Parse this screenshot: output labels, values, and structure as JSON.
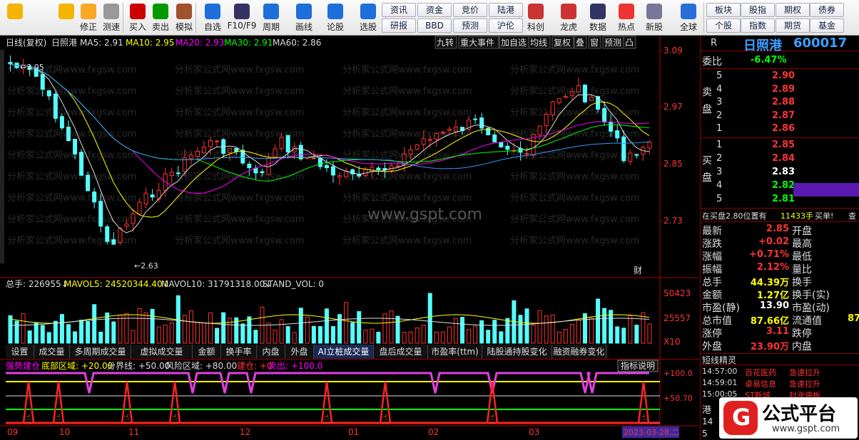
{
  "toolbar": {
    "items": [
      {
        "name": "back-button",
        "label": "",
        "icon": "arrow-left-icon"
      },
      {
        "name": "up-button",
        "label": "",
        "icon": "arrow-up-icon"
      },
      {
        "name": "fix-button",
        "label": "修正",
        "icon": "fix-icon"
      },
      {
        "name": "test-button",
        "label": "测速",
        "icon": "clock-icon"
      },
      {
        "name": "buy-button",
        "label": "买入",
        "icon": "buy-icon"
      },
      {
        "name": "sell-button",
        "label": "卖出",
        "icon": "sell-icon"
      },
      {
        "name": "simulate-button",
        "label": "模拟",
        "icon": "hammer-icon"
      },
      {
        "name": "favorite-button",
        "label": "自选",
        "icon": "star-icon"
      },
      {
        "name": "f10-button",
        "label": "F10/F9",
        "icon": "f10-icon"
      },
      {
        "name": "period-button",
        "label": "周期",
        "icon": "period-icon"
      },
      {
        "name": "draw-button",
        "label": "画线",
        "icon": "pencil-icon"
      },
      {
        "name": "discuss-button",
        "label": "论股",
        "icon": "discuss-icon"
      },
      {
        "name": "select-button",
        "label": "选股",
        "icon": "gauge-icon"
      },
      {
        "name": "fortune-button",
        "label": "科创",
        "icon": "chart-icon"
      },
      {
        "name": "dragon-button",
        "label": "龙虎",
        "icon": "dragon-icon"
      },
      {
        "name": "data-button",
        "label": "数据",
        "icon": "pe-icon"
      },
      {
        "name": "hot-button",
        "label": "热点",
        "icon": "fire-icon"
      },
      {
        "name": "ipo-button",
        "label": "新股",
        "icon": "ipo-icon"
      },
      {
        "name": "global-button",
        "label": "全球",
        "icon": "globe-icon"
      }
    ],
    "small": [
      "资讯",
      "资金",
      "竞价",
      "陆港",
      "研报",
      "BBD",
      "预测",
      "沪伦"
    ],
    "right": [
      "板块",
      "股指",
      "期权",
      "债券",
      "个股",
      "指数",
      "期货",
      "基金"
    ]
  },
  "header": {
    "period": "日线(复权)",
    "stock": "日照港",
    "ma5": "MA5: 2.91",
    "ma10": "MA10: 2.95",
    "ma20": "MA20: 2.93",
    "ma30": "MA30: 2.91",
    "ma60": "MA60: 2.86",
    "tools": [
      "九转",
      "重大事件",
      "加自选",
      "均线",
      "复权",
      "叠",
      "窗",
      "预测",
      "凸"
    ]
  },
  "price_axis": [
    "3.09",
    "2.97",
    "2.85",
    "2.73"
  ],
  "hi_label": "3.05",
  "lo_label": "2.63",
  "fin_mark": "财",
  "watermark": "www.gspt.com",
  "watermark_small": "分析家公式网www.fxgsw.com",
  "volume": {
    "label": "总手: 226955↓",
    "mavol5": "MAVOL5: 24520344.40↓",
    "mavol10": "MAVOL10: 31791318.00↓",
    "stand": "STAND_VOL: 0",
    "axis": [
      "50423",
      "25557",
      "X10"
    ]
  },
  "tabs": [
    "设置",
    "成交量",
    "多周期成交量",
    "虚拟成交量",
    "金额",
    "换手率",
    "内盘",
    "外盘",
    "AI立桩成交量",
    "盘后成交量",
    "市盈率(ttm)",
    "陆股通持股变化",
    "融资融券变化"
  ],
  "active_tab": "AI立桩成交量",
  "indicator": {
    "l1": "强势建仓",
    "l2": "底部区域: +20.00",
    "l3": "分界线: +50.00",
    "l4": "风险区域: +80.00",
    "l5": "建仓: +0",
    "l6": "卖出: +100.0",
    "btn": "指标说明",
    "axis": [
      "+100.0",
      "+50.70"
    ]
  },
  "dates": [
    "09",
    "10",
    "11",
    "12",
    "01",
    "02",
    "03",
    "2023-03-28,二"
  ],
  "right_panel": {
    "r": "R",
    "name": "日照港",
    "code": "600017",
    "weibi_label": "委比",
    "weibi": "-6.47%",
    "sell_label": "卖盘",
    "buy_label": "买盘",
    "sells": [
      {
        "n": "5",
        "p": "2.90"
      },
      {
        "n": "4",
        "p": "2.89"
      },
      {
        "n": "3",
        "p": "2.88"
      },
      {
        "n": "2",
        "p": "2.87"
      },
      {
        "n": "1",
        "p": "2.86"
      }
    ],
    "buys": [
      {
        "n": "1",
        "p": "2.85"
      },
      {
        "n": "2",
        "p": "2.84"
      },
      {
        "n": "3",
        "p": "2.83"
      },
      {
        "n": "4",
        "p": "2.82"
      },
      {
        "n": "5",
        "p": "2.81"
      }
    ],
    "notice_a": "在买盘2.80位置有",
    "notice_b": "11433手",
    "notice_c": "买单!",
    "notice_d": "查",
    "stats": [
      {
        "l": "最新",
        "v": "2.85",
        "l2": "开盘"
      },
      {
        "l": "涨跌",
        "v": "+0.02",
        "l2": "最高"
      },
      {
        "l": "涨幅",
        "v": "+0.71%",
        "l2": "最低"
      },
      {
        "l": "振幅",
        "v": "2.12%",
        "l2": "量比"
      },
      {
        "l": "总手",
        "v": "44.39万",
        "l2": "换手"
      },
      {
        "l": "金额",
        "v": "1.27亿",
        "l2": "换手(实)"
      },
      {
        "l": "市盈(静)",
        "v": "13.90",
        "l2": "市盈(动)"
      },
      {
        "l": "总市值",
        "v": "87.66亿",
        "l2": "流通值",
        "v2": "87"
      },
      {
        "l": "涨停",
        "v": "3.11",
        "l2": "跌停"
      },
      {
        "l": "外盘",
        "v": "23.90万",
        "l2": "内盘"
      }
    ],
    "news_title": "短线精灵",
    "news": [
      {
        "t": "14:57:00",
        "s": "百花医药",
        "e": "急速拉升"
      },
      {
        "t": "14:59:01",
        "s": "卓易信息",
        "e": "急速拉升"
      },
      {
        "t": "15:00:05",
        "s": "ST新城",
        "e": "封涨停板"
      }
    ],
    "brand": "公式平台",
    "brand_url": "www.gspt.com",
    "side": "港",
    "side_b": "14",
    "side_c": "5"
  }
}
